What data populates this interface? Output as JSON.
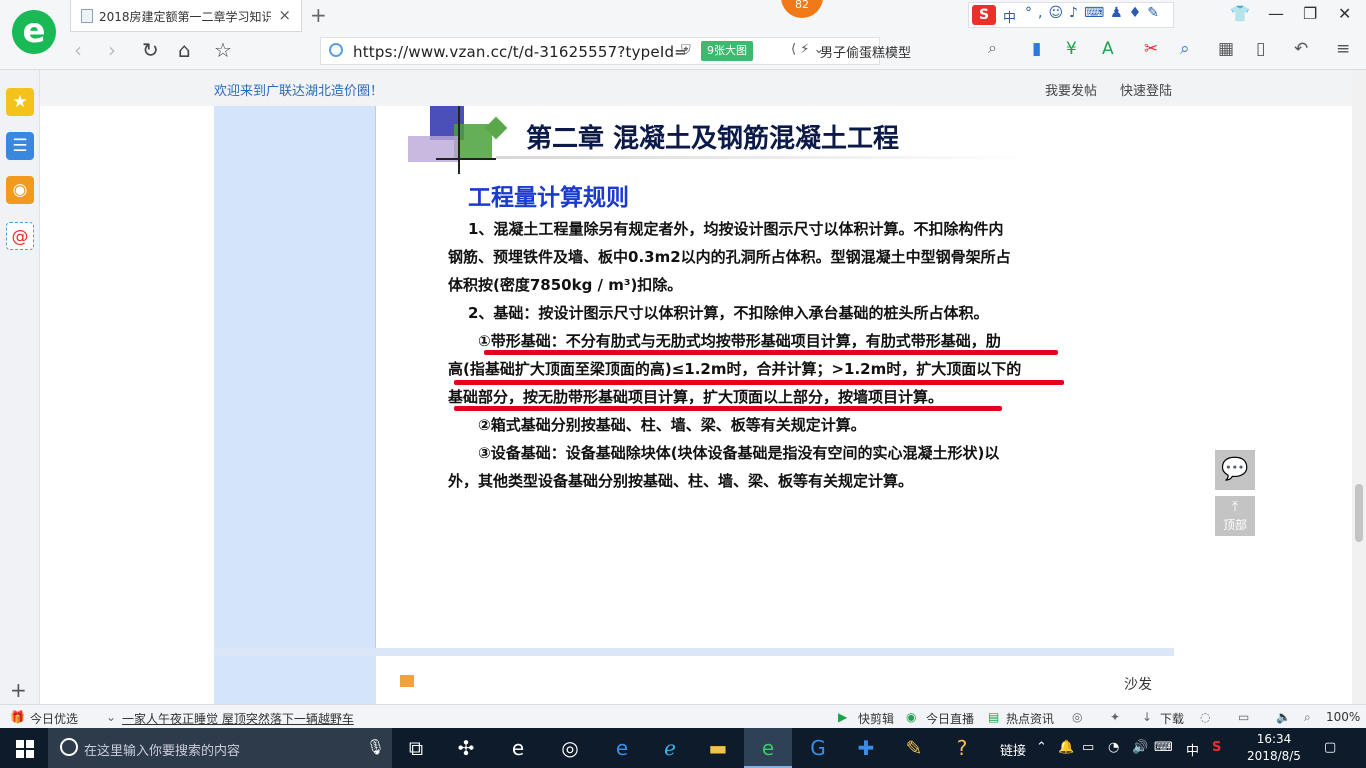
{
  "browser": {
    "tab_title": "2018房建定额第一二章学习知识",
    "tab_close": "×",
    "new_tab": "+",
    "badge": "82",
    "url": "https://www.vzan.cc/t/d-31625557?typeId=",
    "big_image_label": "9张大图",
    "search_query": "男子偷蛋糕模型",
    "sogou_label": "中"
  },
  "site": {
    "welcome": "欢迎来到广联达湖北造价圈！",
    "post": "我要发帖",
    "login": "快速登陆"
  },
  "slide": {
    "title": "第二章  混凝土及钢筋混凝土工程",
    "subtitle": "工程量计算规则",
    "lines": [
      "1、混凝土工程量除另有规定者外，均按设计图示尺寸以体积计算。不扣除构件内",
      "钢筋、预埋铁件及墙、板中0.3m2以内的孔洞所占体积。型钢混凝土中型钢骨架所占",
      "体积按(密度7850kg / m³)扣除。",
      "2、基础：按设计图示尺寸以体积计算，不扣除伸入承台基础的桩头所占体积。",
      "①带形基础：不分有肋式与无肋式均按带形基础项目计算，有肋式带形基础，肋",
      "高(指基础扩大顶面至梁顶面的高)≤1.2m时，合并计算；>1.2m时，扩大顶面以下的",
      "基础部分，按无肋带形基础项目计算，扩大顶面以上部分，按墙项目计算。",
      "②箱式基础分别按基础、柱、墙、梁、板等有关规定计算。",
      "③设备基础：设备基础除块体(块体设备基础是指没有空间的实心混凝土形状)以",
      "外，其他类型设备基础分别按基础、柱、墙、梁、板等有关规定计算。"
    ]
  },
  "reply": {
    "sofa": "沙发"
  },
  "floating": {
    "top_label": "顶部"
  },
  "statusbar": {
    "today_pick": "今日优选",
    "news": "一家人午夜正睡觉 屋顶突然落下一辆越野车",
    "cut": "快剪辑",
    "live": "今日直播",
    "hot": "热点资讯",
    "download": "下载",
    "zoom": "100%"
  },
  "taskbar": {
    "search_placeholder": "在这里输入你要搜索的内容",
    "links": "链接",
    "ime": "中",
    "time": "16:34",
    "date": "2018/8/5"
  }
}
